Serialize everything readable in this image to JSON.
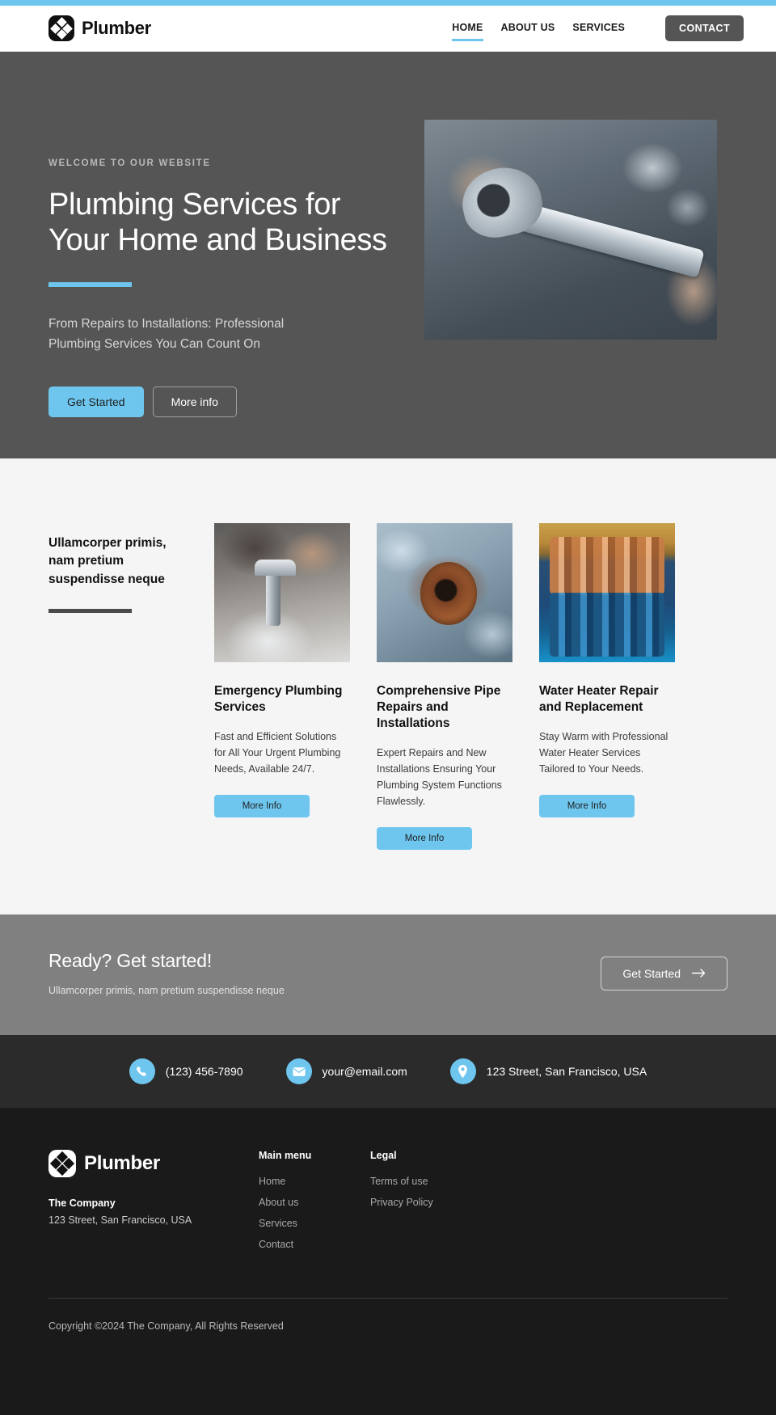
{
  "theme": {
    "accent": "#6ec6ee",
    "hero_bg": "#555555",
    "services_bg": "#f5f5f5",
    "cta_bg": "#808080",
    "contact_bar_bg": "#2b2b2b",
    "footer_bg": "#1a1a1a"
  },
  "navbar": {
    "brand": "Plumber",
    "logo_icon": "diamond-cross-logo-icon",
    "links": [
      {
        "label": "HOME",
        "active": true
      },
      {
        "label": "ABOUT US",
        "active": false
      },
      {
        "label": "SERVICES",
        "active": false
      }
    ],
    "contact_button": "CONTACT"
  },
  "hero": {
    "eyebrow": "WELCOME TO OUR WEBSITE",
    "title": "Plumbing Services for Your Home and Business",
    "subtitle": "From Repairs to Installations: Professional Plumbing Services You Can Count On",
    "primary_button": "Get Started",
    "secondary_button": "More info",
    "image_alt": "plumber-holding-wrench-photo"
  },
  "services": {
    "heading": "Ullamcorper primis, nam pretium suspendisse neque",
    "cards": [
      {
        "title": "Emergency Plumbing Services",
        "description": "Fast and Efficient Solutions for All Your Urgent Plumbing Needs, Available 24/7.",
        "button": "More Info",
        "image_alt": "hands-under-running-faucet-photo"
      },
      {
        "title": "Comprehensive Pipe Repairs and Installations",
        "description": "Expert Repairs and New Installations Ensuring Your Plumbing System Functions Flawlessly.",
        "button": "More Info",
        "image_alt": "burst-pipe-with-water-photo"
      },
      {
        "title": "Water Heater Repair and Replacement",
        "description": "Stay Warm with Professional Water Heater Services Tailored to Your Needs.",
        "button": "More Info",
        "image_alt": "copper-pipe-manifold-photo"
      }
    ]
  },
  "cta": {
    "title": "Ready? Get started!",
    "subtitle": "Ullamcorper primis, nam pretium suspendisse neque",
    "button": "Get Started",
    "button_icon": "arrow-right-icon"
  },
  "contact_bar": {
    "items": [
      {
        "icon": "phone-icon",
        "value": "(123) 456-7890"
      },
      {
        "icon": "envelope-icon",
        "value": "your@email.com"
      },
      {
        "icon": "location-pin-icon",
        "value": "123 Street, San Francisco, USA"
      }
    ]
  },
  "footer": {
    "brand": "Plumber",
    "logo_icon": "diamond-cross-logo-icon",
    "company_name": "The Company",
    "company_address": "123 Street, San Francisco, USA",
    "columns": [
      {
        "heading": "Main menu",
        "links": [
          "Home",
          "About us",
          "Services",
          "Contact"
        ]
      },
      {
        "heading": "Legal",
        "links": [
          "Terms of use",
          "Privacy Policy"
        ]
      }
    ],
    "copyright": "Copyright ©2024 The Company, All Rights Reserved"
  }
}
